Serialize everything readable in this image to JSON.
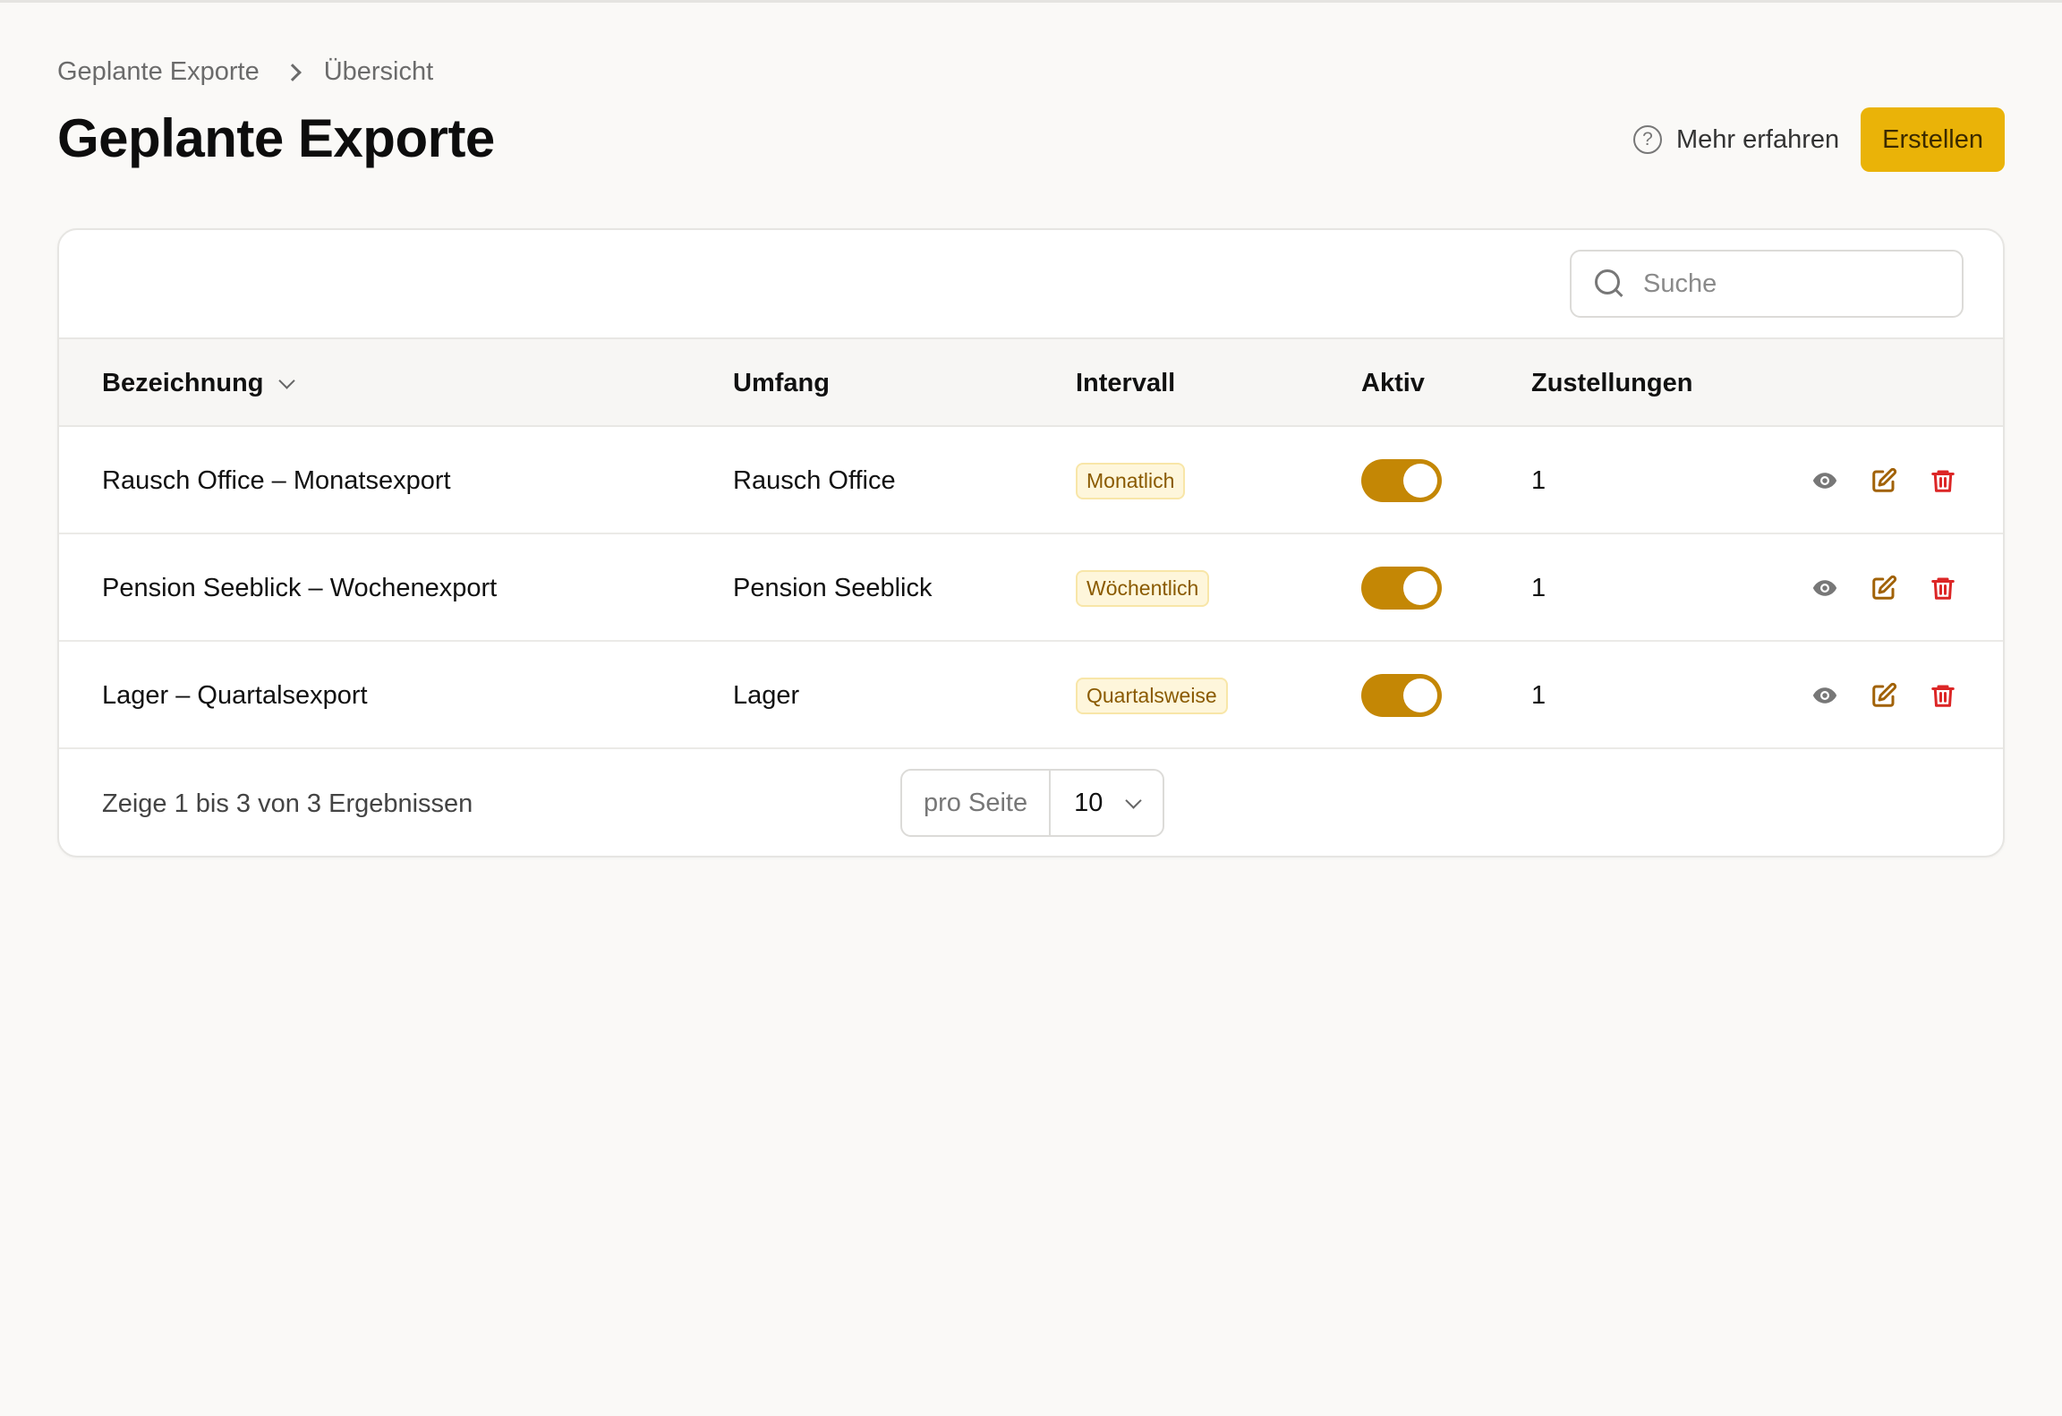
{
  "breadcrumb": {
    "parent": "Geplante Exporte",
    "current": "Übersicht"
  },
  "page": {
    "title": "Geplante Exporte"
  },
  "header": {
    "learn_more": "Mehr erfahren",
    "help_icon": "?",
    "create_label": "Erstellen"
  },
  "search": {
    "placeholder": "Suche"
  },
  "table": {
    "columns": {
      "name": "Bezeichnung",
      "scope": "Umfang",
      "interval": "Intervall",
      "active": "Aktiv",
      "deliveries": "Zustellungen"
    },
    "rows": [
      {
        "name": "Rausch Office – Monatsexport",
        "scope": "Rausch Office",
        "interval": "Monatlich",
        "active": true,
        "deliveries": "1"
      },
      {
        "name": "Pension Seeblick – Wochenexport",
        "scope": "Pension Seeblick",
        "interval": "Wöchentlich",
        "active": true,
        "deliveries": "1"
      },
      {
        "name": "Lager – Quartalsexport",
        "scope": "Lager",
        "interval": "Quartalsweise",
        "active": true,
        "deliveries": "1"
      }
    ]
  },
  "pagination": {
    "summary": "Zeige 1 bis 3 von 3 Ergebnissen",
    "per_page_label": "pro Seite",
    "per_page_value": "10"
  },
  "colors": {
    "accent": "#eab308",
    "toggle_on": "#c48705",
    "edit_icon": "#a16207",
    "delete_icon": "#dc2626",
    "view_icon": "#777777"
  }
}
